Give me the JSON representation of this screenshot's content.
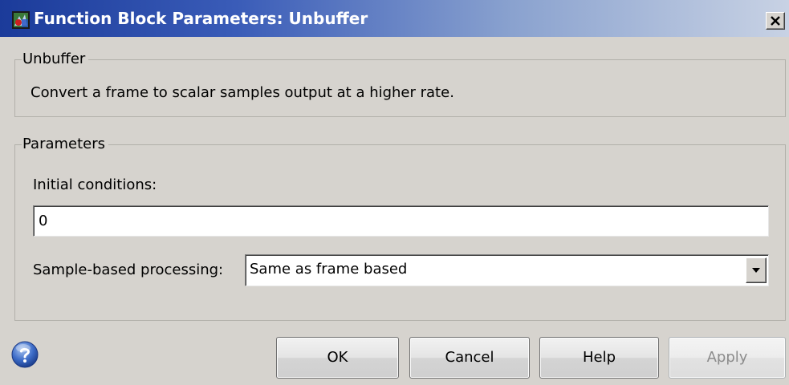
{
  "window": {
    "title": "Function Block Parameters: Unbuffer",
    "icon": "simulink-block-icon",
    "close_icon": "close-icon"
  },
  "block_group": {
    "legend": "Unbuffer",
    "description": "Convert a frame to scalar samples output at a higher rate."
  },
  "parameters_group": {
    "legend": "Parameters",
    "initial_conditions_label": "Initial conditions:",
    "initial_conditions_value": "0",
    "sample_processing_label": "Sample-based processing:",
    "sample_processing_value": "Same as frame based"
  },
  "buttons": {
    "ok": "OK",
    "cancel": "Cancel",
    "help": "Help",
    "apply": "Apply"
  },
  "colors": {
    "titlebar_start": "#1b3b9a",
    "titlebar_end": "#c8d2e4",
    "dialog_bg": "#d6d3ce"
  }
}
